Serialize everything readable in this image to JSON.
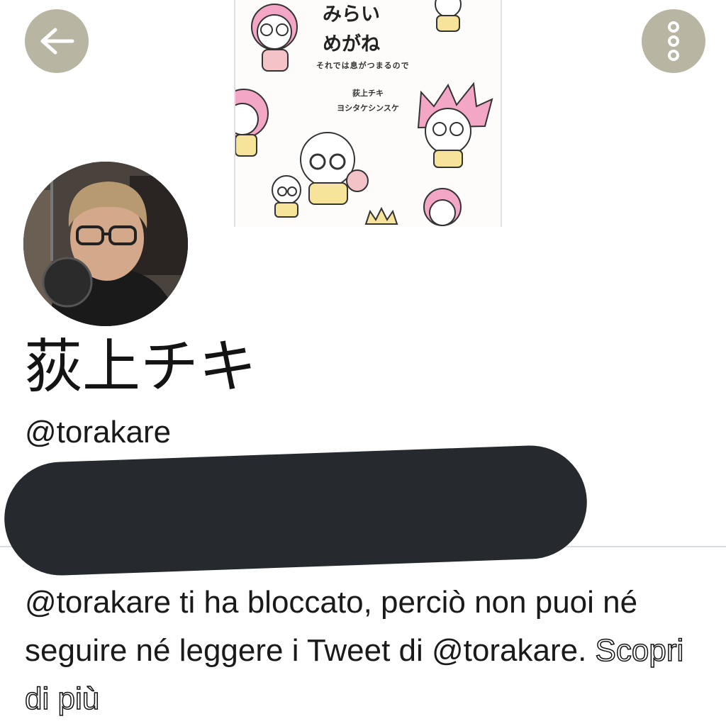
{
  "banner": {
    "book_title_line1": "みらい",
    "book_title_line2": "めがね",
    "book_subtitle": "それでは息がつまるので",
    "book_author1": "荻上チキ",
    "book_author2": "ヨシタケシンスケ"
  },
  "icons": {
    "back": "arrow-left-icon",
    "more": "vertical-dots-icon"
  },
  "colors": {
    "round_button_bg": "#b9b5a3",
    "redaction": "#262a2e",
    "divider": "#d7dde2"
  },
  "profile": {
    "display_name": "荻上チキ",
    "handle": "@torakare"
  },
  "blocked": {
    "message": "@torakare ti ha bloccato, perciò non puoi né seguire né leggere i Tweet di @torakare.",
    "learn_more": "Scopri di più"
  }
}
